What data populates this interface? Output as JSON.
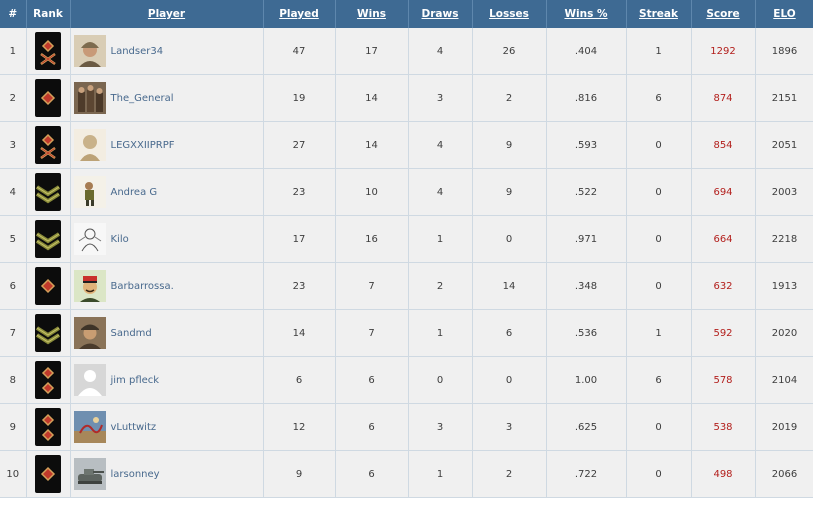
{
  "headers": {
    "num": "#",
    "rank": "Rank",
    "player": "Player",
    "played": "Played",
    "wins": "Wins",
    "draws": "Draws",
    "losses": "Losses",
    "wins_pct": "Wins %",
    "streak": "Streak",
    "score": "Score",
    "elo": "ELO"
  },
  "rows": [
    {
      "num": "1",
      "rank_icon": "crossed-batons-insignia-icon",
      "avatar_icon": "helmet-soldier-avatar-icon",
      "player": "Landser34",
      "played": "47",
      "wins": "17",
      "draws": "4",
      "losses": "26",
      "wins_pct": ".404",
      "streak": "1",
      "score": "1292",
      "elo": "1896"
    },
    {
      "num": "2",
      "rank_icon": "pip-insignia-icon",
      "avatar_icon": "soldiers-group-avatar-icon",
      "player": "The_General",
      "played": "19",
      "wins": "14",
      "draws": "3",
      "losses": "2",
      "wins_pct": ".816",
      "streak": "6",
      "score": "874",
      "elo": "2151"
    },
    {
      "num": "3",
      "rank_icon": "crossed-batons-insignia-icon",
      "avatar_icon": "statue-bust-avatar-icon",
      "player": "LEGXXIIPRPF",
      "played": "27",
      "wins": "14",
      "draws": "4",
      "losses": "9",
      "wins_pct": ".593",
      "streak": "0",
      "score": "854",
      "elo": "2051"
    },
    {
      "num": "4",
      "rank_icon": "chevrons-insignia-icon",
      "avatar_icon": "cartoon-figure-avatar-icon",
      "player": "Andrea G",
      "played": "23",
      "wins": "10",
      "draws": "4",
      "losses": "9",
      "wins_pct": ".522",
      "streak": "0",
      "score": "694",
      "elo": "2003"
    },
    {
      "num": "5",
      "rank_icon": "chevrons-insignia-icon",
      "avatar_icon": "sketch-avatar-icon",
      "player": "Kilo",
      "played": "17",
      "wins": "16",
      "draws": "1",
      "losses": "0",
      "wins_pct": ".971",
      "streak": "0",
      "score": "664",
      "elo": "2218"
    },
    {
      "num": "6",
      "rank_icon": "pip-insignia-icon",
      "avatar_icon": "officer-avatar-icon",
      "player": "Barbarrossa.",
      "played": "23",
      "wins": "7",
      "draws": "2",
      "losses": "14",
      "wins_pct": ".348",
      "streak": "0",
      "score": "632",
      "elo": "1913"
    },
    {
      "num": "7",
      "rank_icon": "chevrons-insignia-icon",
      "avatar_icon": "officer-cap-avatar-icon",
      "player": "Sandmd",
      "played": "14",
      "wins": "7",
      "draws": "1",
      "losses": "6",
      "wins_pct": ".536",
      "streak": "1",
      "score": "592",
      "elo": "2020"
    },
    {
      "num": "8",
      "rank_icon": "two-pips-insignia-icon",
      "avatar_icon": "default-user-avatar-icon",
      "player": "jim pfleck",
      "played": "6",
      "wins": "6",
      "draws": "0",
      "losses": "0",
      "wins_pct": "1.00",
      "streak": "6",
      "score": "578",
      "elo": "2104"
    },
    {
      "num": "9",
      "rank_icon": "two-pips-insignia-icon",
      "avatar_icon": "painting-avatar-icon",
      "player": "vLuttwitz",
      "played": "12",
      "wins": "6",
      "draws": "3",
      "losses": "3",
      "wins_pct": ".625",
      "streak": "0",
      "score": "538",
      "elo": "2019"
    },
    {
      "num": "10",
      "rank_icon": "pip-insignia-icon",
      "avatar_icon": "tank-avatar-icon",
      "player": "larsonney",
      "played": "9",
      "wins": "6",
      "draws": "1",
      "losses": "2",
      "wins_pct": ".722",
      "streak": "0",
      "score": "498",
      "elo": "2066"
    }
  ],
  "colors": {
    "header_bg": "#3e6a93",
    "row_bg": "#f0f0f0",
    "grid": "#cfd9e2",
    "link": "#48698d",
    "score": "#b3201d",
    "insignia_bg": "#0c0c0c",
    "insignia_red": "#c0392b",
    "insignia_gold": "#d4a05a",
    "chevron_olive": "#8a8c3a"
  }
}
